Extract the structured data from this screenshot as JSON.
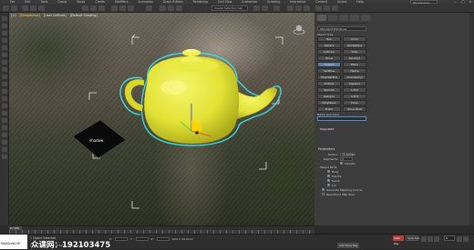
{
  "menubar": {
    "items": [
      "File",
      "Edit",
      "Tools",
      "Group",
      "Views",
      "Create",
      "Modifiers",
      "Animation",
      "Graph Editors",
      "Rendering",
      "Civil View",
      "Customize",
      "Scripting",
      "Interactive",
      "Content",
      "Arnold",
      "Help"
    ],
    "workspace_label": "Workspaces:",
    "window_controls": [
      "–",
      "□",
      "×"
    ]
  },
  "toolbar": {
    "selection_set_placeholder": "Create Selection Set"
  },
  "viewport": {
    "labels": [
      "[+]",
      "[Perspective]",
      "[User Defined]",
      "[Default Shading]"
    ],
    "object_label": "shadow",
    "colors": {
      "teapot": "#ecec3c",
      "selection_outline": "#3fe0e0"
    }
  },
  "command_panel": {
    "category_dropdown": "Standard Primitives",
    "object_type_header": "Object Type",
    "autogrid_label": "AutoGrid",
    "buttons": [
      "Box",
      "Cone",
      "Sphere",
      "GeoSphere",
      "Cylinder",
      "Tube",
      "Torus",
      "Pyramid",
      "Teapot",
      "Plane",
      "TextPlus",
      "Hedra",
      "ChamferBox",
      "ChamferCyl",
      "OilTank",
      "Capsule",
      "Spindle",
      "L-Ext",
      "Gengon",
      "C-Ext",
      "RingWave",
      "Hose",
      "Prism",
      "Torus Knot"
    ],
    "selected_button_index": 8,
    "name_color_header": "Name and Color",
    "object_name": "Teapot001",
    "parameters_header": "Parameters",
    "radius_label": "Radius:",
    "radius_value": "25.009mm",
    "segments_label": "Segments:",
    "segments_value": "4",
    "smooth_label": "Smooth",
    "teapot_parts_label": "Teapot Parts:",
    "parts": [
      "Body",
      "Handle",
      "Spout",
      "Lid"
    ],
    "gen_mapping_label": "Generate Mapping Coords.",
    "real_world_label": "Real-World Map Size"
  },
  "timeline": {
    "frame_label": "0 / 100",
    "ruler_ticks": [
      "0",
      "5",
      "10",
      "15",
      "20",
      "25",
      "30",
      "35",
      "40",
      "45",
      "50",
      "55",
      "60",
      "65",
      "70",
      "75",
      "80",
      "85",
      "90",
      "95",
      "100"
    ]
  },
  "statusbar": {
    "maxscript_label": "MAXScript Mi",
    "selection_info": "1 Object Selected",
    "prompt": "Click or click-and-drag to select objects",
    "coord_labels": [
      "X:",
      "Y:",
      "Z:"
    ],
    "grid_label": "Grid = 10.0mm",
    "add_time_tag": "Add Time Tag",
    "auto_key": "Auto Key",
    "set_key": "Selected",
    "frame_value": "0"
  },
  "watermark": {
    "text": "众课网：192103475"
  }
}
